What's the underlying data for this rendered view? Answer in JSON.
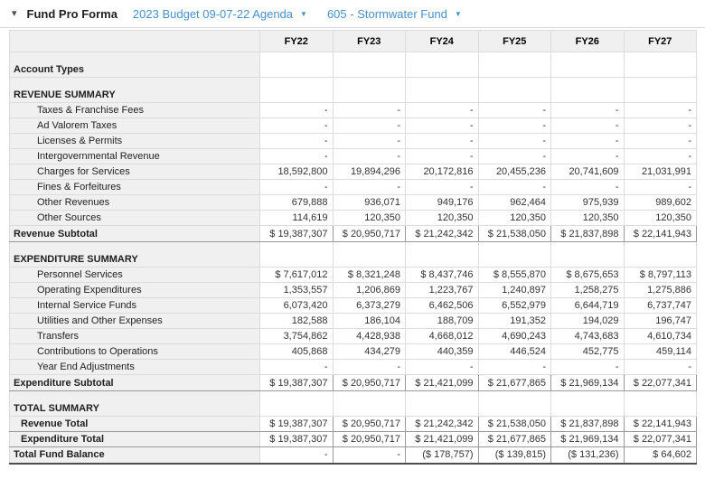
{
  "toolbar": {
    "collapse_icon": "▾",
    "title": "Fund Pro Forma",
    "budget_selector": "2023 Budget 09-07-22 Agenda",
    "fund_selector": "605 - Stormwater Fund",
    "dropdown_caret": "▼",
    "link_color": "#4a8fc8"
  },
  "table": {
    "columns": [
      "FY22",
      "FY23",
      "FY24",
      "FY25",
      "FY26",
      "FY27"
    ],
    "rows": [
      {
        "type": "section",
        "label": "Account Types",
        "values": [
          "",
          "",
          "",
          "",
          "",
          ""
        ]
      },
      {
        "type": "section",
        "label": "REVENUE SUMMARY",
        "values": [
          "",
          "",
          "",
          "",
          "",
          ""
        ]
      },
      {
        "type": "item",
        "label": "Taxes & Franchise Fees",
        "values": [
          "-",
          "-",
          "-",
          "-",
          "-",
          "-"
        ]
      },
      {
        "type": "item",
        "label": "Ad Valorem Taxes",
        "values": [
          "-",
          "-",
          "-",
          "-",
          "-",
          "-"
        ]
      },
      {
        "type": "item",
        "label": "Licenses & Permits",
        "values": [
          "-",
          "-",
          "-",
          "-",
          "-",
          "-"
        ]
      },
      {
        "type": "item",
        "label": "Intergovernmental Revenue",
        "values": [
          "-",
          "-",
          "-",
          "-",
          "-",
          "-"
        ]
      },
      {
        "type": "item",
        "label": "Charges for Services",
        "values": [
          "18,592,800",
          "19,894,296",
          "20,172,816",
          "20,455,236",
          "20,741,609",
          "21,031,991"
        ]
      },
      {
        "type": "item",
        "label": "Fines & Forfeitures",
        "values": [
          "-",
          "-",
          "-",
          "-",
          "-",
          "-"
        ]
      },
      {
        "type": "item",
        "label": "Other Revenues",
        "values": [
          "679,888",
          "936,071",
          "949,176",
          "962,464",
          "975,939",
          "989,602"
        ]
      },
      {
        "type": "item",
        "label": "Other Sources",
        "values": [
          "114,619",
          "120,350",
          "120,350",
          "120,350",
          "120,350",
          "120,350"
        ]
      },
      {
        "type": "subtotal",
        "label": "Revenue Subtotal",
        "values": [
          "$ 19,387,307",
          "$ 20,950,717",
          "$ 21,242,342",
          "$ 21,538,050",
          "$ 21,837,898",
          "$ 22,141,943"
        ]
      },
      {
        "type": "section",
        "label": "EXPENDITURE SUMMARY",
        "values": [
          "",
          "",
          "",
          "",
          "",
          ""
        ]
      },
      {
        "type": "item",
        "label": "Personnel Services",
        "values": [
          "$ 7,617,012",
          "$ 8,321,248",
          "$ 8,437,746",
          "$ 8,555,870",
          "$ 8,675,653",
          "$ 8,797,113"
        ]
      },
      {
        "type": "item",
        "label": "Operating Expenditures",
        "values": [
          "1,353,557",
          "1,206,869",
          "1,223,767",
          "1,240,897",
          "1,258,275",
          "1,275,886"
        ]
      },
      {
        "type": "item",
        "label": "Internal Service Funds",
        "values": [
          "6,073,420",
          "6,373,279",
          "6,462,506",
          "6,552,979",
          "6,644,719",
          "6,737,747"
        ]
      },
      {
        "type": "item",
        "label": "Utilities and Other Expenses",
        "values": [
          "182,588",
          "186,104",
          "188,709",
          "191,352",
          "194,029",
          "196,747"
        ]
      },
      {
        "type": "item",
        "label": "Transfers",
        "values": [
          "3,754,862",
          "4,428,938",
          "4,668,012",
          "4,690,243",
          "4,743,683",
          "4,610,734"
        ]
      },
      {
        "type": "item",
        "label": "Contributions to Operations",
        "values": [
          "405,868",
          "434,279",
          "440,359",
          "446,524",
          "452,775",
          "459,114"
        ]
      },
      {
        "type": "item",
        "label": "Year End Adjustments",
        "values": [
          "-",
          "-",
          "-",
          "-",
          "-",
          "-"
        ]
      },
      {
        "type": "subtotal",
        "label": "Expenditure Subtotal",
        "values": [
          "$ 19,387,307",
          "$ 20,950,717",
          "$ 21,421,099",
          "$ 21,677,865",
          "$ 21,969,134",
          "$ 22,077,341"
        ]
      },
      {
        "type": "section",
        "label": "TOTAL SUMMARY",
        "values": [
          "",
          "",
          "",
          "",
          "",
          ""
        ]
      },
      {
        "type": "totalitem",
        "label": "Revenue Total",
        "values": [
          "$ 19,387,307",
          "$ 20,950,717",
          "$ 21,242,342",
          "$ 21,538,050",
          "$ 21,837,898",
          "$ 22,141,943"
        ]
      },
      {
        "type": "totalitem",
        "label": "Expenditure Total",
        "values": [
          "$ 19,387,307",
          "$ 20,950,717",
          "$ 21,421,099",
          "$ 21,677,865",
          "$ 21,969,134",
          "$ 22,077,341"
        ]
      },
      {
        "type": "grand",
        "label": "Total Fund Balance",
        "values": [
          "-",
          "-",
          "($ 178,757)",
          "($ 139,815)",
          "($ 131,236)",
          "$ 64,602"
        ]
      }
    ]
  }
}
